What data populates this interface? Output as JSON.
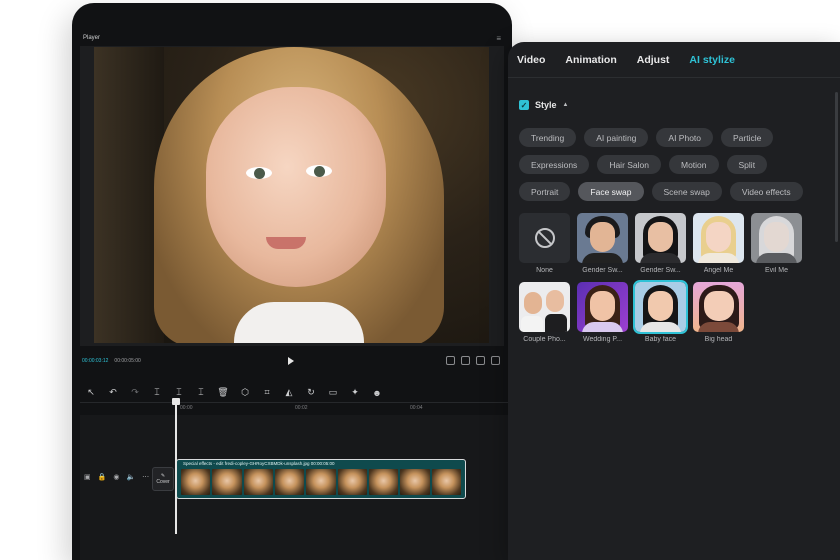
{
  "player": {
    "title": "Player",
    "current_time": "00:00:03:12",
    "total_time": "00:00:05:00"
  },
  "timeline": {
    "ruler": [
      "00:00",
      "00:02",
      "00:04"
    ],
    "cover_label": "Cover",
    "clip_label": "Special effects - edit   fredi-copley-GHRoyCXBMDk-unsplash.jpg   00:00:05:00"
  },
  "panel": {
    "tabs": [
      {
        "label": "Video",
        "active": false
      },
      {
        "label": "Animation",
        "active": false
      },
      {
        "label": "Adjust",
        "active": false
      },
      {
        "label": "AI stylize",
        "active": true
      }
    ],
    "style_label": "Style",
    "chips": [
      [
        "Trending",
        "AI painting",
        "AI Photo",
        "Particle"
      ],
      [
        "Expressions",
        "Hair Salon",
        "Motion",
        "Split"
      ],
      [
        "Portrait",
        "Face swap",
        "Scene swap",
        "Video effects"
      ]
    ],
    "active_chip": "Face swap",
    "effects_row1": [
      "None",
      "Gender Sw...",
      "Gender Sw...",
      "Angel Me",
      "Evil Me"
    ],
    "effects_row2": [
      "Couple Pho...",
      "Wedding P...",
      "Baby face",
      "Big head"
    ],
    "selected_effect": "Baby face"
  },
  "colors": {
    "accent": "#2fc2d6",
    "panel_bg": "#1e1f22",
    "chip_bg": "#35373b"
  }
}
